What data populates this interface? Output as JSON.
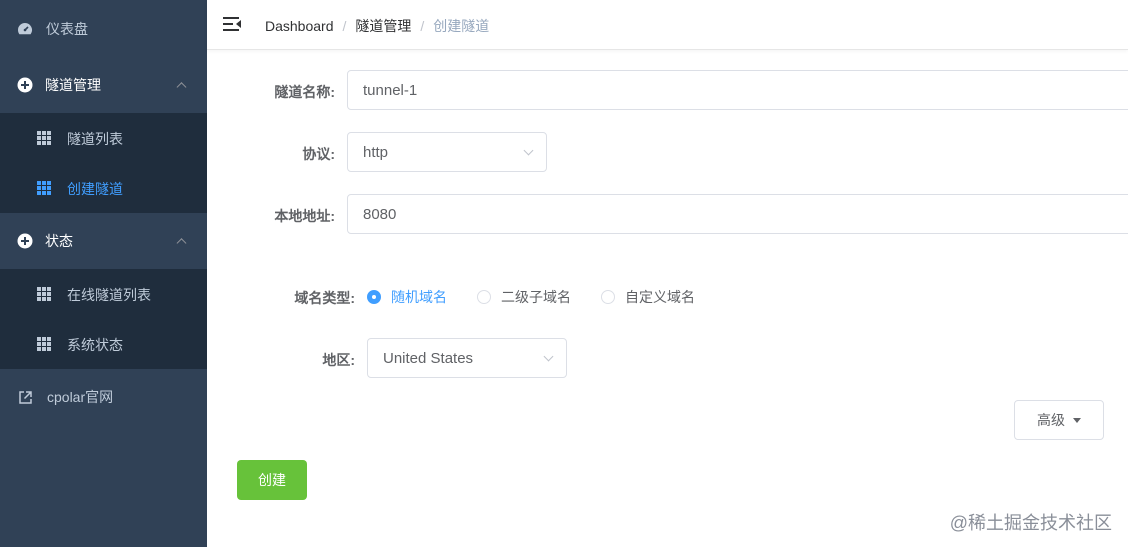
{
  "sidebar": {
    "dashboard": {
      "label": "仪表盘",
      "icon": "dashboard-icon"
    },
    "tunnel_mgmt": {
      "label": "隧道管理",
      "icon": "plus-circle-icon"
    },
    "tunnel_list": {
      "label": "隧道列表",
      "icon": "table-icon"
    },
    "create_tunnel": {
      "label": "创建隧道",
      "icon": "table-icon"
    },
    "status": {
      "label": "状态",
      "icon": "plus-circle-icon"
    },
    "online_tunnels": {
      "label": "在线隧道列表",
      "icon": "table-icon"
    },
    "system_status": {
      "label": "系统状态",
      "icon": "table-icon"
    },
    "cpolar_site": {
      "label": "cpolar官网",
      "icon": "external-link-icon"
    }
  },
  "breadcrumb": [
    "Dashboard",
    "隧道管理",
    "创建隧道"
  ],
  "form": {
    "name_label": "隧道名称:",
    "name_value": "tunnel-1",
    "protocol_label": "协议:",
    "protocol_value": "http",
    "local_addr_label": "本地地址:",
    "local_addr_value": "8080",
    "domain_type_label": "域名类型:",
    "domain_options": [
      "随机域名",
      "二级子域名",
      "自定义域名"
    ],
    "domain_selected": "随机域名",
    "region_label": "地区:",
    "region_value": "United States"
  },
  "advanced_label": "高级",
  "create_label": "创建",
  "watermark": "@稀土掘金技术社区",
  "colors": {
    "sidebar_bg": "#304156",
    "submenu_bg": "#1f2d3d",
    "active": "#409eff",
    "create_btn": "#67c23a"
  }
}
